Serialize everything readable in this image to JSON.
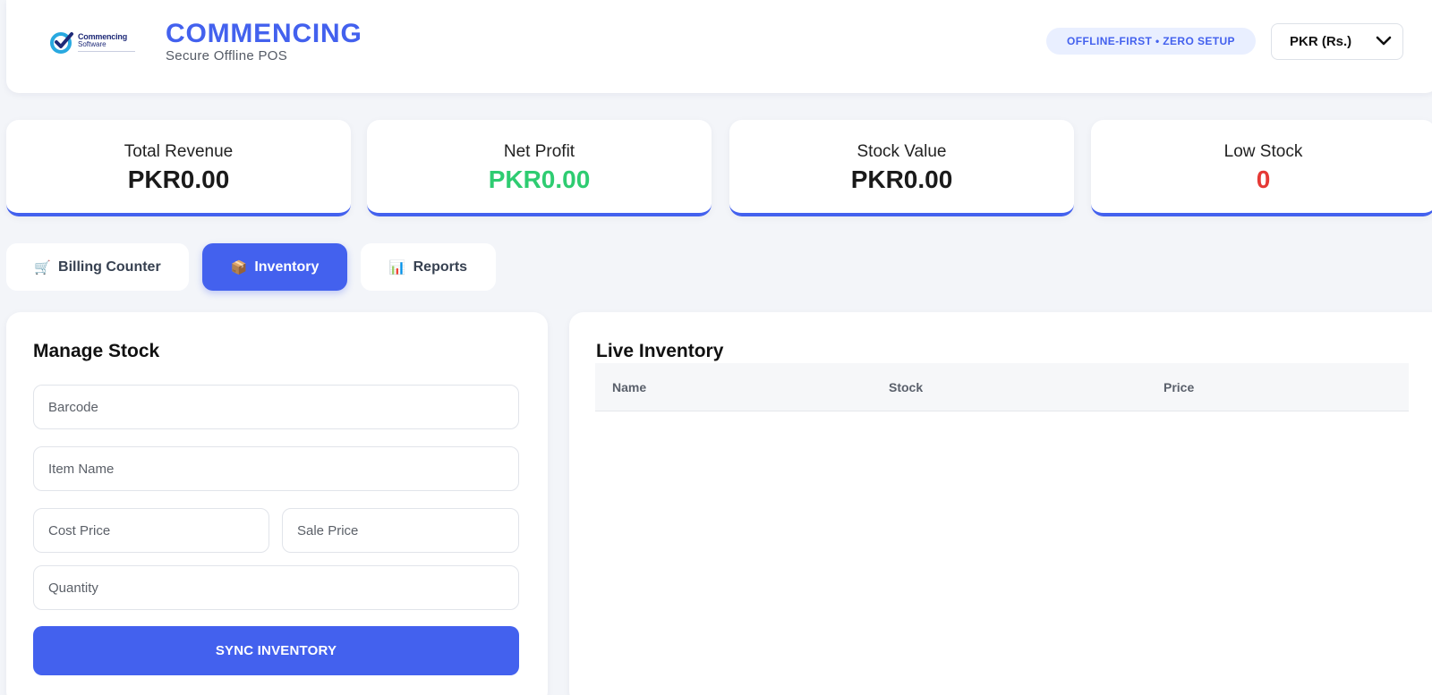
{
  "header": {
    "logo_text_1": "Commencing",
    "logo_text_2": "Software",
    "title": "COMMENCING",
    "subtitle": "Secure Offline POS",
    "badge": "OFFLINE-FIRST • ZERO SETUP",
    "currency_selected": "PKR (Rs.)",
    "colors": {
      "accent": "#4361ee",
      "badge_bg": "#e9efff"
    }
  },
  "stats": [
    {
      "label": "Total Revenue",
      "value": "PKR0.00"
    },
    {
      "label": "Net Profit",
      "value": "PKR0.00",
      "color": "#2ecc71"
    },
    {
      "label": "Stock Value",
      "value": "PKR0.00"
    },
    {
      "label": "Low Stock",
      "value": "0",
      "color": "#e53935"
    }
  ],
  "tabs": [
    {
      "icon": "🛒",
      "icon_name": "cart-icon",
      "label": "Billing Counter",
      "active": false
    },
    {
      "icon": "📦",
      "icon_name": "package-icon",
      "label": "Inventory",
      "active": true
    },
    {
      "icon": "📊",
      "icon_name": "chart-icon",
      "label": "Reports",
      "active": false
    }
  ],
  "manage_stock": {
    "title": "Manage Stock",
    "barcode_placeholder": "Barcode",
    "item_name_placeholder": "Item Name",
    "cost_price_placeholder": "Cost Price",
    "sale_price_placeholder": "Sale Price",
    "quantity_placeholder": "Quantity",
    "sync_label": "SYNC INVENTORY"
  },
  "live_inventory": {
    "title": "Live Inventory",
    "columns": [
      "Name",
      "Stock",
      "Price"
    ],
    "rows": []
  }
}
